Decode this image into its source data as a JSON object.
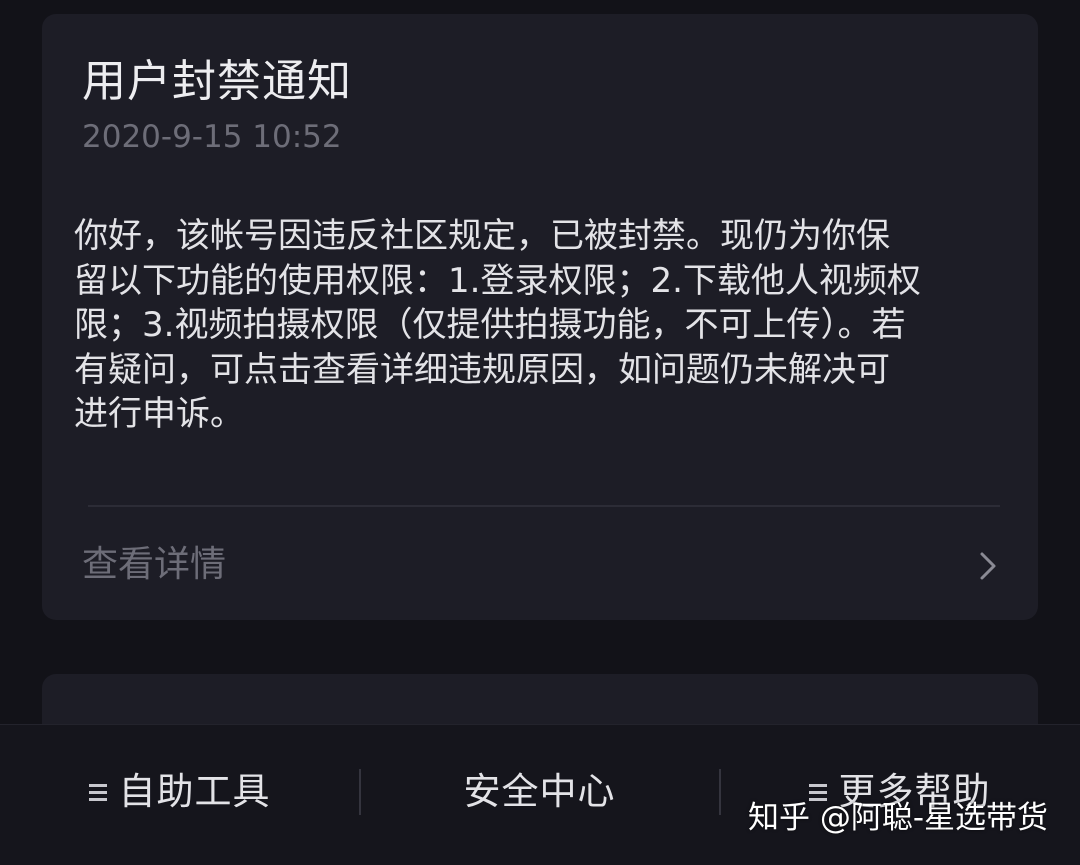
{
  "notice": {
    "title": "用户封禁通知",
    "time": "2020-9-15 10:52",
    "body_lines": [
      "你好，该帐号因违反社区规定，已被封禁。现仍为你保",
      "留以下功能的使用权限：1.登录权限；2.下载他人视频权",
      "限；3.视频拍摄权限（仅提供拍摄功能，不可上传）。若",
      "有疑问，可点击查看详细违规原因，如问题仍未解决可",
      "进行申诉。"
    ],
    "details_label": "查看详情",
    "details_icon": "chevron-right-icon"
  },
  "tabbar": {
    "tabs": [
      {
        "label": "自助工具",
        "icon": "menu-icon"
      },
      {
        "label": "安全中心"
      },
      {
        "label": "更多帮助",
        "icon": "menu-icon"
      }
    ]
  },
  "watermark": "知乎 @阿聪-星选带货",
  "colors": {
    "background": "#121218",
    "card": "#1d1d26",
    "primary_text": "#ededf0",
    "secondary_text": "#6d6d78"
  }
}
